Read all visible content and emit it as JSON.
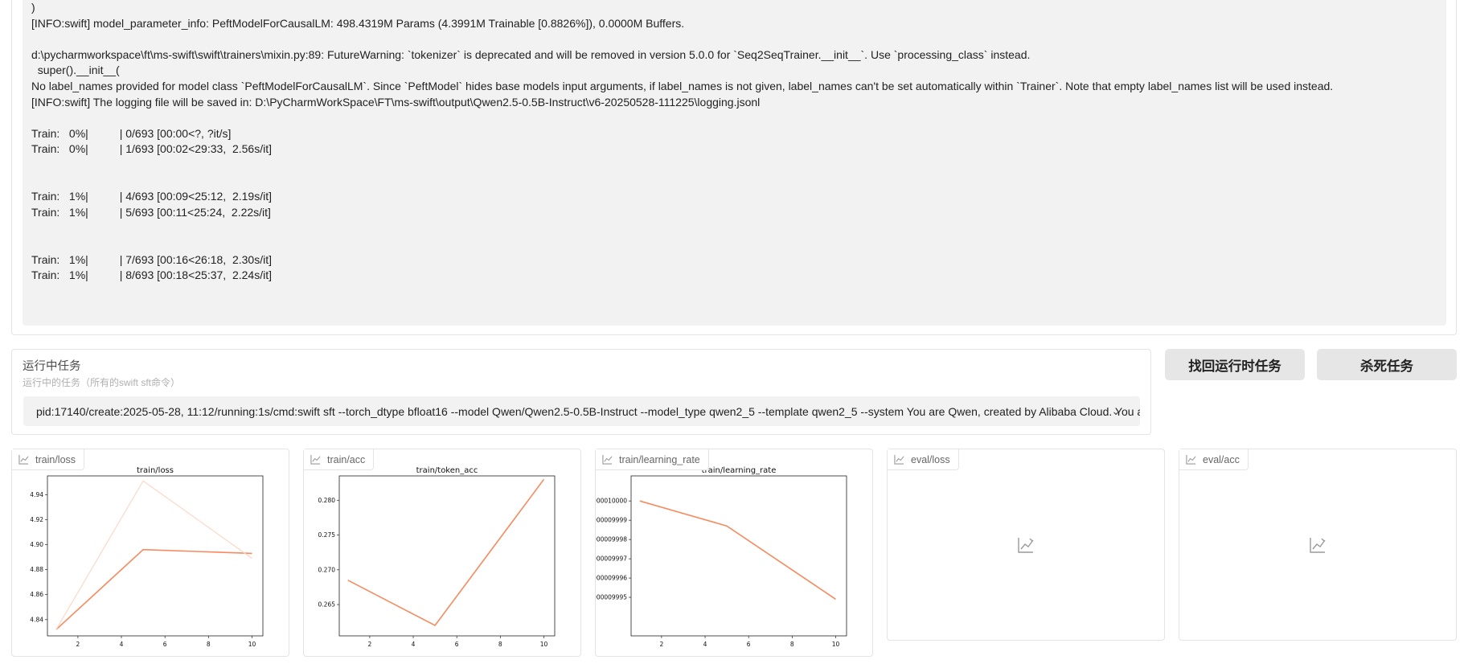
{
  "log": {
    "lines": [
      ")",
      "[INFO:swift] model_parameter_info: PeftModelForCausalLM: 498.4319M Params (4.3991M Trainable [0.8826%]), 0.0000M Buffers.",
      "",
      "d:\\pycharmworkspace\\ft\\ms-swift\\swift\\trainers\\mixin.py:89: FutureWarning: `tokenizer` is deprecated and will be removed in version 5.0.0 for `Seq2SeqTrainer.__init__`. Use `processing_class` instead.",
      "  super().__init__(",
      "No label_names provided for model class `PeftModelForCausalLM`. Since `PeftModel` hides base models input arguments, if label_names is not given, label_names can't be set automatically within `Trainer`. Note that empty label_names list will be used instead.",
      "[INFO:swift] The logging file will be saved in: D:\\PyCharmWorkSpace\\FT\\ms-swift\\output\\Qwen2.5-0.5B-Instruct\\v6-20250528-111225\\logging.jsonl",
      "",
      "Train:   0%|          | 0/693 [00:00<?, ?it/s]",
      "Train:   0%|          | 1/693 [00:02<29:33,  2.56s/it]",
      "",
      "",
      "Train:   1%|          | 4/693 [00:09<25:12,  2.19s/it]",
      "Train:   1%|          | 5/693 [00:11<25:24,  2.22s/it]",
      "",
      "",
      "Train:   1%|          | 7/693 [00:16<26:18,  2.30s/it]",
      "Train:   1%|          | 8/693 [00:18<25:37,  2.24s/it]"
    ]
  },
  "task_panel": {
    "title": "运行中任务",
    "subtitle": "运行中的任务（所有的swift sft命令）",
    "selected": "pid:17140/create:2025-05-28, 11:12/running:1s/cmd:swift sft --torch_dtype bfloat16 --model Qwen/Qwen2.5-0.5B-Instruct --model_type qwen2_5 --template qwen2_5 --system You are Qwen, created by Alibaba Cloud. You are a helpful assistant.",
    "chevron_icon": "chevron-down-icon"
  },
  "buttons": {
    "recover": "找回运行时任务",
    "kill": "杀死任务"
  },
  "plots": [
    {
      "label": "train/loss",
      "icon": "chart-icon"
    },
    {
      "label": "train/acc",
      "icon": "chart-icon"
    },
    {
      "label": "train/learning_rate",
      "icon": "chart-icon"
    },
    {
      "label": "eval/loss",
      "icon": "chart-icon"
    },
    {
      "label": "eval/acc",
      "icon": "chart-icon"
    }
  ],
  "colors": {
    "line": "#f78a5f",
    "line_faint": "#fad9c8",
    "panel_bg": "#f2f2f2",
    "button_bg": "#e6e6e6"
  },
  "chart_data": [
    {
      "type": "line",
      "title": "train/loss",
      "xlim": [
        0.6,
        10.5
      ],
      "ylim": [
        4.827,
        4.955
      ],
      "xticks": [
        2,
        4,
        6,
        8,
        10
      ],
      "yticks": [
        4.84,
        4.86,
        4.88,
        4.9,
        4.92,
        4.94
      ],
      "ytick_labels": [
        "4.84",
        "4.86",
        "4.88",
        "4.90",
        "4.92",
        "4.94"
      ],
      "series": [
        {
          "x": [
            1,
            5,
            10
          ],
          "y": [
            4.832,
            4.896,
            4.893
          ],
          "style": "main"
        },
        {
          "x": [
            1,
            5,
            10
          ],
          "y": [
            4.832,
            4.951,
            4.889
          ],
          "style": "faint"
        }
      ]
    },
    {
      "type": "line",
      "title": "train/token_acc",
      "xlim": [
        0.6,
        10.5
      ],
      "ylim": [
        0.2605,
        0.2835
      ],
      "xticks": [
        2,
        4,
        6,
        8,
        10
      ],
      "yticks": [
        0.265,
        0.27,
        0.275,
        0.28
      ],
      "ytick_labels": [
        "0.265",
        "0.270",
        "0.275",
        "0.280"
      ],
      "series": [
        {
          "x": [
            1,
            5,
            10
          ],
          "y": [
            0.2685,
            0.262,
            0.283
          ],
          "style": "main"
        }
      ]
    },
    {
      "type": "line",
      "title": "train/learning_rate",
      "xlim": [
        0.6,
        10.5
      ],
      "ylim": [
        9.99993e-05,
        0.00010000013
      ],
      "xticks": [
        2,
        4,
        6,
        8,
        10
      ],
      "yticks": [
        9.99995e-05,
        9.99996e-05,
        9.99997e-05,
        9.99998e-05,
        9.99999e-05,
        0.0001
      ],
      "ytick_labels": [
        "000009995",
        "000009996",
        "000009997",
        "000009998",
        "000009999",
        "000010000"
      ],
      "series": [
        {
          "x": [
            1,
            5,
            10
          ],
          "y": [
            0.0001,
            9.999987e-05,
            9.999949e-05
          ],
          "style": "main"
        }
      ]
    }
  ]
}
